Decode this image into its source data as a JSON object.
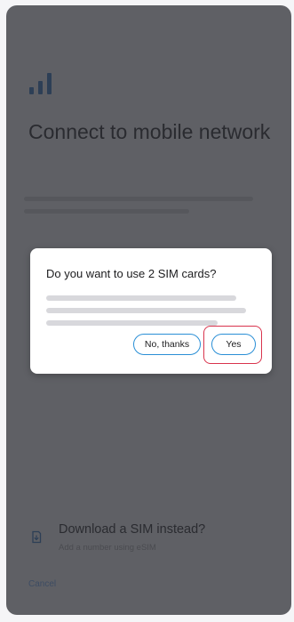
{
  "page": {
    "title": "Connect to mobile network"
  },
  "dialog": {
    "title": "Do you want to use 2 SIM cards?",
    "buttons": {
      "no_label": "No, thanks",
      "yes_label": "Yes"
    }
  },
  "download_option": {
    "title": "Download a SIM instead?",
    "subtitle": "Add a number using eSIM",
    "icon": "sim-download-icon"
  },
  "cancel_label": "Cancel",
  "icons": {
    "header": "signal-bars-icon"
  },
  "colors": {
    "scrim_background": "#5f6065",
    "accent": "#2a8fd6",
    "highlight": "#d9344d"
  }
}
